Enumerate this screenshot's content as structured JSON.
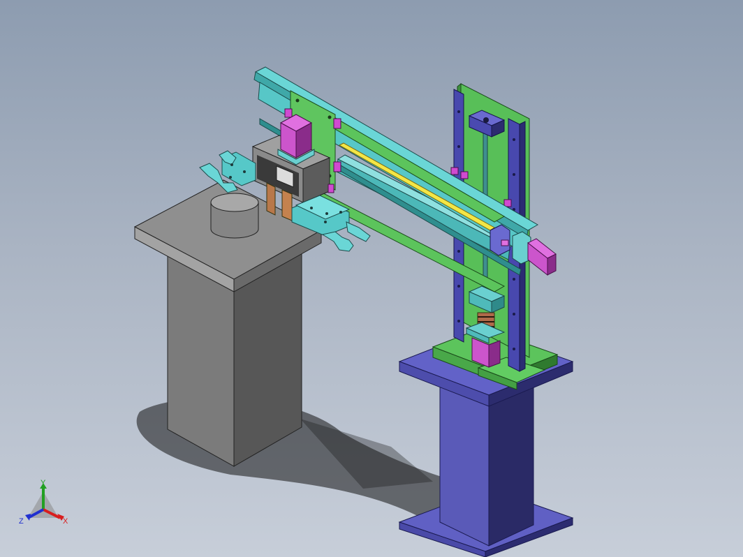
{
  "triad": {
    "y_label": "Y",
    "z_label": "Z",
    "x_label": "X",
    "colors": {
      "x": "#d81e1e",
      "y": "#22a022",
      "z": "#2030d0"
    }
  },
  "model": {
    "part_colors": {
      "table_top": "#8e8e8e",
      "table_leg": "#7a7a7a",
      "blue_base": "#5a5ab8",
      "green_plate": "#5fc55f",
      "cyan_part": "#4fc2c2",
      "magenta_motor": "#cc55cc",
      "blue_rail": "#4a4ab0",
      "lead_screw": "#f0e040"
    }
  }
}
